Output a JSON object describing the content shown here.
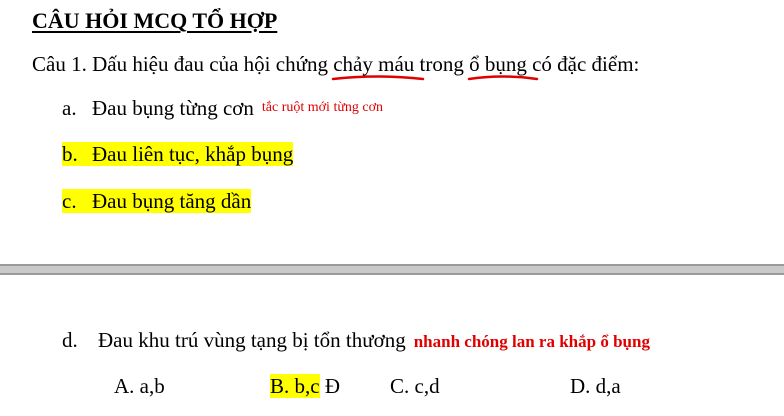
{
  "title": "CÂU HỎI MCQ TỔ HỢP",
  "question": {
    "prefix": "Câu 1. Dấu hiệu đau của hội chứng ",
    "term1": "chảy máu",
    "middle": " trong ",
    "term2": "ổ bụng",
    "suffix": " có đặc điểm:"
  },
  "options": [
    {
      "letter": "a.",
      "text": "Đau bụng từng cơn",
      "note": "tắc ruột mới từng cơn",
      "highlighted": false
    },
    {
      "letter": "b.",
      "text": "Đau liên tục, khắp bụng",
      "note": "",
      "highlighted": true
    },
    {
      "letter": "c.",
      "text": "Đau bụng tăng dần",
      "note": "",
      "highlighted": true
    },
    {
      "letter": "d.",
      "text": "Đau khu trú vùng tạng bị tổn thương",
      "note": "nhanh chóng lan ra khắp ổ bụng",
      "highlighted": false
    }
  ],
  "answers": [
    {
      "label": "A. a,b",
      "highlighted": false,
      "mark": ""
    },
    {
      "label": "B. b,c",
      "highlighted": true,
      "mark": "Đ"
    },
    {
      "label": "C. c,d",
      "highlighted": false,
      "mark": ""
    },
    {
      "label": "D. d,a",
      "highlighted": false,
      "mark": ""
    }
  ],
  "colors": {
    "highlight": "#ffff00",
    "annotation": "#e00000",
    "divider": "#c9c9c9"
  }
}
